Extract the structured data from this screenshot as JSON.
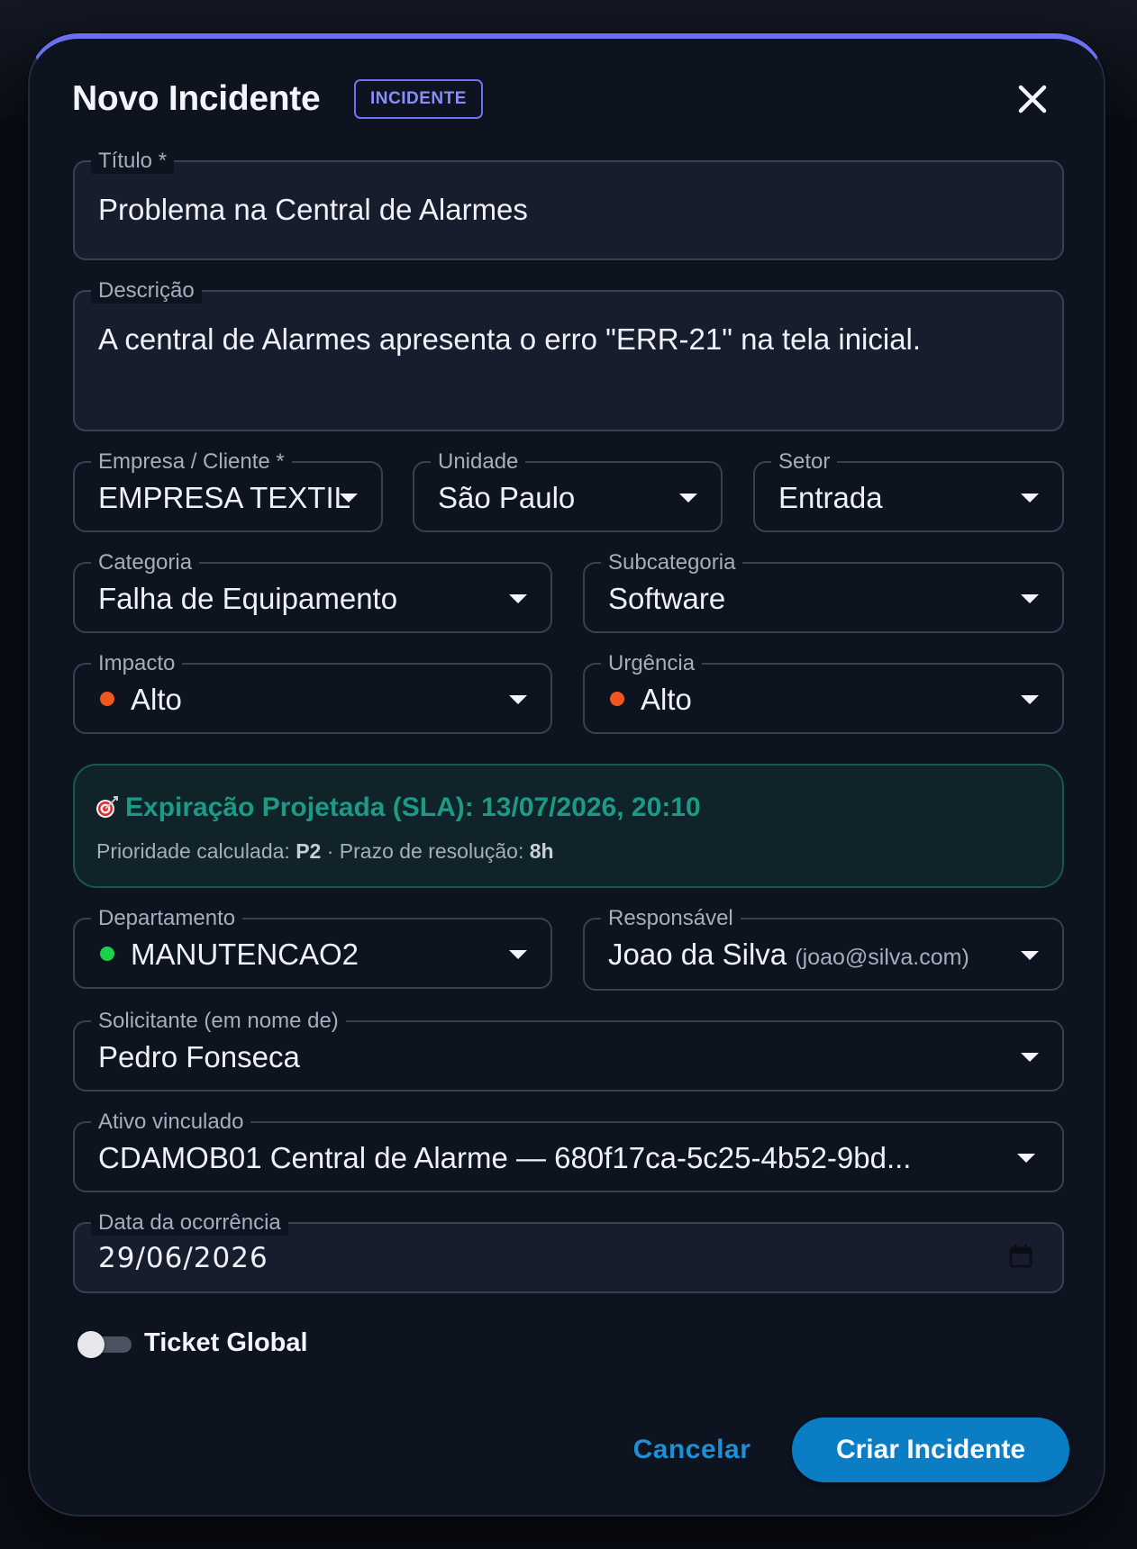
{
  "dialog": {
    "title": "Novo Incidente",
    "badge": "INCIDENTE",
    "accent_color": "#6a70ee"
  },
  "fields": {
    "titulo": {
      "label": "Título *",
      "value": "Problema na Central de Alarmes"
    },
    "descricao": {
      "label": "Descrição",
      "value": "A central de Alarmes apresenta o erro \"ERR-21\" na tela inicial."
    },
    "empresa": {
      "label": "Empresa / Cliente *",
      "value": "EMPRESA TEXTIL"
    },
    "unidade": {
      "label": "Unidade",
      "value": "São Paulo"
    },
    "setor": {
      "label": "Setor",
      "value": "Entrada"
    },
    "categoria": {
      "label": "Categoria",
      "value": "Falha de Equipamento"
    },
    "subcategoria": {
      "label": "Subcategoria",
      "value": "Software"
    },
    "impacto": {
      "label": "Impacto",
      "value": "Alto",
      "dot_color": "#f0571f"
    },
    "urgencia": {
      "label": "Urgência",
      "value": "Alto",
      "dot_color": "#f0571f"
    },
    "departamento": {
      "label": "Departamento",
      "value": "MANUTENCAO2",
      "dot_color": "#19d24a"
    },
    "responsavel": {
      "label": "Responsável",
      "value": "Joao da Silva",
      "email": "(joao@silva.com)"
    },
    "solicitante": {
      "label": "Solicitante (em nome de)",
      "value": "Pedro Fonseca"
    },
    "ativo": {
      "label": "Ativo vinculado",
      "value": "CDAMOB01 Central de Alarme — 680f17ca-5c25-4b52-9bd..."
    },
    "data": {
      "label": "Data da ocorrência",
      "value": "29/06/2026"
    }
  },
  "sla": {
    "title": "Expiração Projetada (SLA): 13/07/2026, 20:10",
    "prioridade_label": "Prioridade calculada:",
    "prioridade_value": "P2",
    "separator": "·",
    "prazo_label": "Prazo de resolução:",
    "prazo_value": "8h",
    "accent_color": "#1c9a86"
  },
  "ticket_global": {
    "label": "Ticket Global",
    "enabled": false
  },
  "actions": {
    "cancel_label": "Cancelar",
    "create_label": "Criar Incidente",
    "primary_color": "#0b7dc4"
  }
}
